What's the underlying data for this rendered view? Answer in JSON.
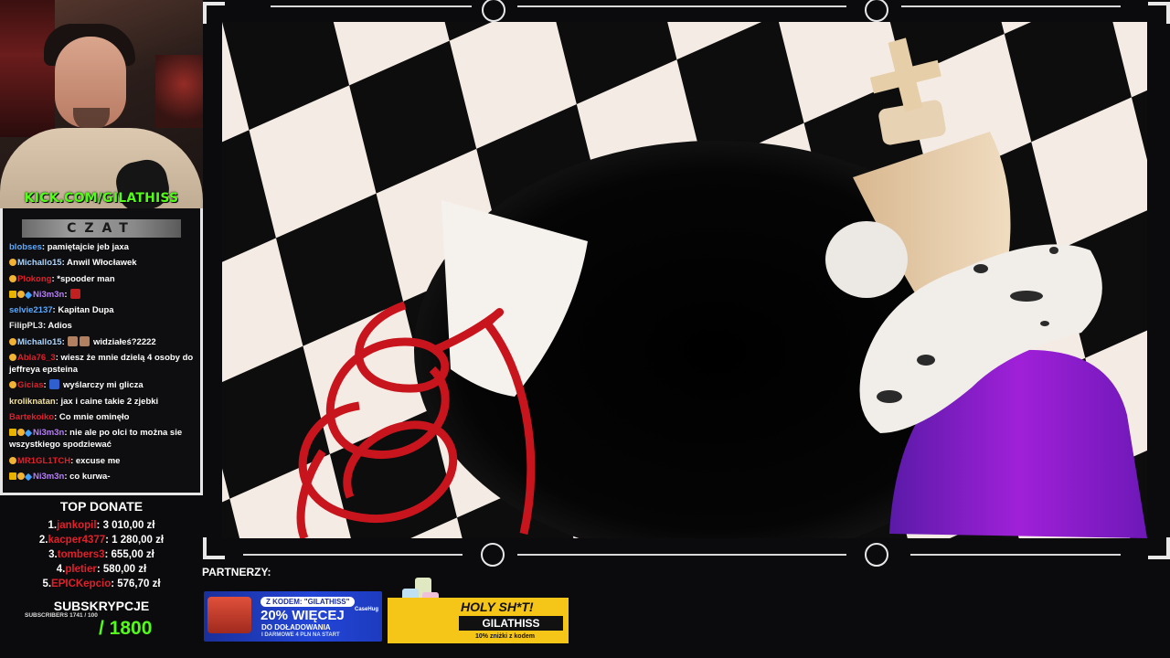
{
  "streamer": {
    "url": "KICK.COM/GILATHISS"
  },
  "chat": {
    "title": "CZAT",
    "messages": [
      {
        "user": "blobses",
        "user_color": "#5aa9ff",
        "badges": [],
        "emotes": [],
        "text": "pamiętajcie jeb jaxa"
      },
      {
        "user": "Michallo15",
        "user_color": "#a8d4ff",
        "badges": [
          "coin"
        ],
        "emotes": [],
        "text": "Anwil Włocławek"
      },
      {
        "user": "Plokong",
        "user_color": "#e0202a",
        "badges": [
          "coin"
        ],
        "emotes": [],
        "text": "*spooder man"
      },
      {
        "user": "Ni3m3n",
        "user_color": "#b97cff",
        "badges": [
          "crown",
          "coin",
          "gem"
        ],
        "emotes": [
          "devil-emote"
        ],
        "text": ""
      },
      {
        "user": "selvie2137",
        "user_color": "#5aa9ff",
        "badges": [],
        "emotes": [],
        "text": "Kapitan Dupa"
      },
      {
        "user": "FilipPL3",
        "user_color": "#e8e8e8",
        "badges": [],
        "emotes": [],
        "text": "Adios"
      },
      {
        "user": "Michallo15",
        "user_color": "#a8d4ff",
        "badges": [
          "coin"
        ],
        "emotes": [
          "face-emote",
          "face-emote"
        ],
        "text": "widziałeś?2222"
      },
      {
        "user": "Abla76_3",
        "user_color": "#e0202a",
        "badges": [
          "coin"
        ],
        "emotes": [],
        "text": "wiesz że mnie dzielą 4 osoby do jeffreya epsteina"
      },
      {
        "user": "Gicias",
        "user_color": "#e0202a",
        "badges": [
          "coin"
        ],
        "emotes": [
          "car-emote"
        ],
        "text": "wyślarczy mi glicza"
      },
      {
        "user": "kroliknatan",
        "user_color": "#f3e3a0",
        "badges": [],
        "emotes": [],
        "text": "jax i caine takie 2 zjebki"
      },
      {
        "user": "Bartekoiko",
        "user_color": "#e0202a",
        "badges": [],
        "emotes": [],
        "text": "Co mnie ominęło"
      },
      {
        "user": "Ni3m3n",
        "user_color": "#b97cff",
        "badges": [
          "crown",
          "coin",
          "gem"
        ],
        "emotes": [],
        "text": "nie ale po olci to można sie wszystkiego spodziewać"
      },
      {
        "user": "MR1GL1TCH",
        "user_color": "#e0202a",
        "badges": [
          "coin"
        ],
        "emotes": [],
        "text": "excuse me"
      },
      {
        "user": "Ni3m3n",
        "user_color": "#b97cff",
        "badges": [
          "crown",
          "coin",
          "gem"
        ],
        "emotes": [],
        "text": "co kurwa-"
      }
    ]
  },
  "top_donate": {
    "title": "TOP DONATE",
    "entries": [
      {
        "rank": "1.",
        "name": "jankopil",
        "amount": ": 3 010,00 zł"
      },
      {
        "rank": "2.",
        "name": "kacper4377",
        "amount": ": 1 280,00 zł"
      },
      {
        "rank": "3.",
        "name": "tombers3",
        "amount": ": 655,00 zł"
      },
      {
        "rank": "4.",
        "name": "pletier",
        "amount": ": 580,00 zł"
      },
      {
        "rank": "5.",
        "name": "EPICKepcio",
        "amount": ": 576,70 zł"
      }
    ]
  },
  "subs": {
    "title": "SUBSKRYPCJE",
    "small": "SUBSCRIBERS 1741 / 100",
    "goal": "/ 1800"
  },
  "partners": {
    "label": "PARTNERZY:",
    "banner1": {
      "code_label": "Z KODEM: \"GILATHISS\"",
      "brand": "CaseHug",
      "headline": "20% WIĘCEJ",
      "sub": "DO DOŁADOWANIA",
      "extra": "I DARMOWE 4 PLN NA START"
    },
    "banner2": {
      "headline": "HOLY SH*T!",
      "code": "GILATHISS",
      "sub": "10% zniżki z kodem"
    }
  },
  "colors": {
    "kick_green": "#53fc18",
    "donor_red": "#e0202a",
    "background": "#0b0b0d"
  }
}
